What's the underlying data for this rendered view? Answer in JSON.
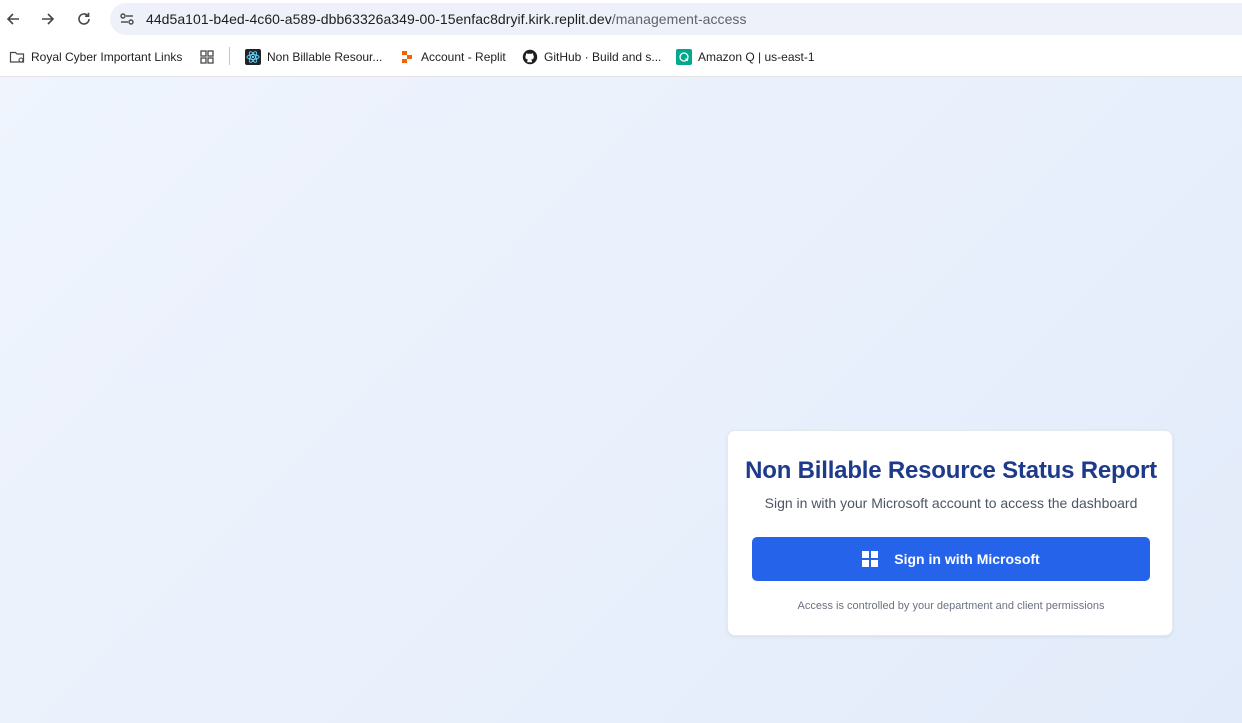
{
  "browser": {
    "url_host": "44d5a101-b4ed-4c60-a589-dbb63326a349-00-15enfac8dryif.kirk.replit.dev",
    "url_path": "/management-access",
    "icons": [
      "back-icon",
      "forward-icon",
      "reload-icon",
      "site-info-icon"
    ]
  },
  "bookmarks": [
    {
      "label": "Royal Cyber Important Links",
      "icon": "folder-settings-icon"
    },
    {
      "label": "",
      "icon": "apps-grid-icon"
    },
    {
      "label": "Non Billable Resour...",
      "icon": "react-icon"
    },
    {
      "label": "Account - Replit",
      "icon": "replit-icon"
    },
    {
      "label": "GitHub · Build and s...",
      "icon": "github-icon"
    },
    {
      "label": "Amazon Q | us-east-1",
      "icon": "amazon-q-icon"
    }
  ],
  "login": {
    "title": "Non Billable Resource Status Report",
    "subtitle": "Sign in with your Microsoft account to access the dashboard",
    "button_label": "Sign in with Microsoft",
    "note": "Access is controlled by your department and client permissions"
  },
  "colors": {
    "primary": "#2563eb",
    "title": "#1e3a8a",
    "page_background": "#e9f0fc"
  }
}
